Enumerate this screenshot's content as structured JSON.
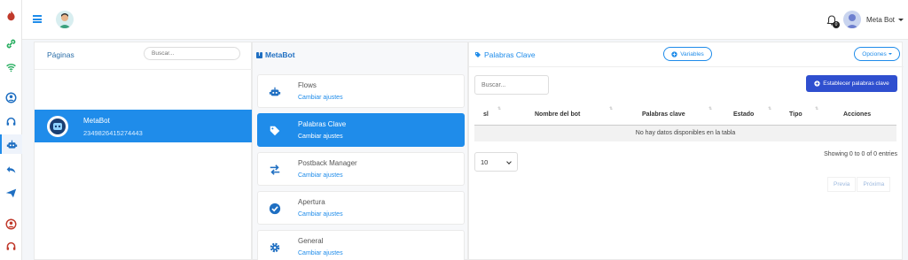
{
  "topbar": {
    "user_name": "Meta Bot",
    "notification_count": "0"
  },
  "pages_panel": {
    "title": "Páginas",
    "search_placeholder": "Buscar...",
    "items": [
      {
        "name": "MetaBot",
        "id": "2349826415274443"
      }
    ]
  },
  "metabot_panel": {
    "title": "MetaBot",
    "settings": [
      {
        "title": "Flows",
        "action": "Cambiar ajustes",
        "icon": "robot-icon"
      },
      {
        "title": "Palabras Clave",
        "action": "Cambiar ajustes",
        "icon": "tag-icon",
        "active": true
      },
      {
        "title": "Postback Manager",
        "action": "Cambiar ajustes",
        "icon": "exchange-icon"
      },
      {
        "title": "Apertura",
        "action": "Cambiar ajustes",
        "icon": "check-circle-icon"
      },
      {
        "title": "General",
        "action": "Cambiar ajustes",
        "icon": "gear-icon"
      }
    ]
  },
  "keywords_panel": {
    "title": "Palabras Clave",
    "variables_label": "Variables",
    "options_label": "Opciones",
    "search_placeholder": "Buscar...",
    "add_button_label": "Establecer palabras clave",
    "table": {
      "columns": [
        "sl",
        "Nombre del bot",
        "Palabras clave",
        "Estado",
        "Tipo",
        "Acciones"
      ],
      "empty_message": "No hay datos disponibles en la tabla"
    },
    "page_length": "10",
    "info_text": "Showing 0 to 0 of 0 entries",
    "prev_label": "Previa",
    "next_label": "Próxima"
  },
  "colors": {
    "primary": "#1f8cea",
    "add_button": "#2f4fcf"
  }
}
